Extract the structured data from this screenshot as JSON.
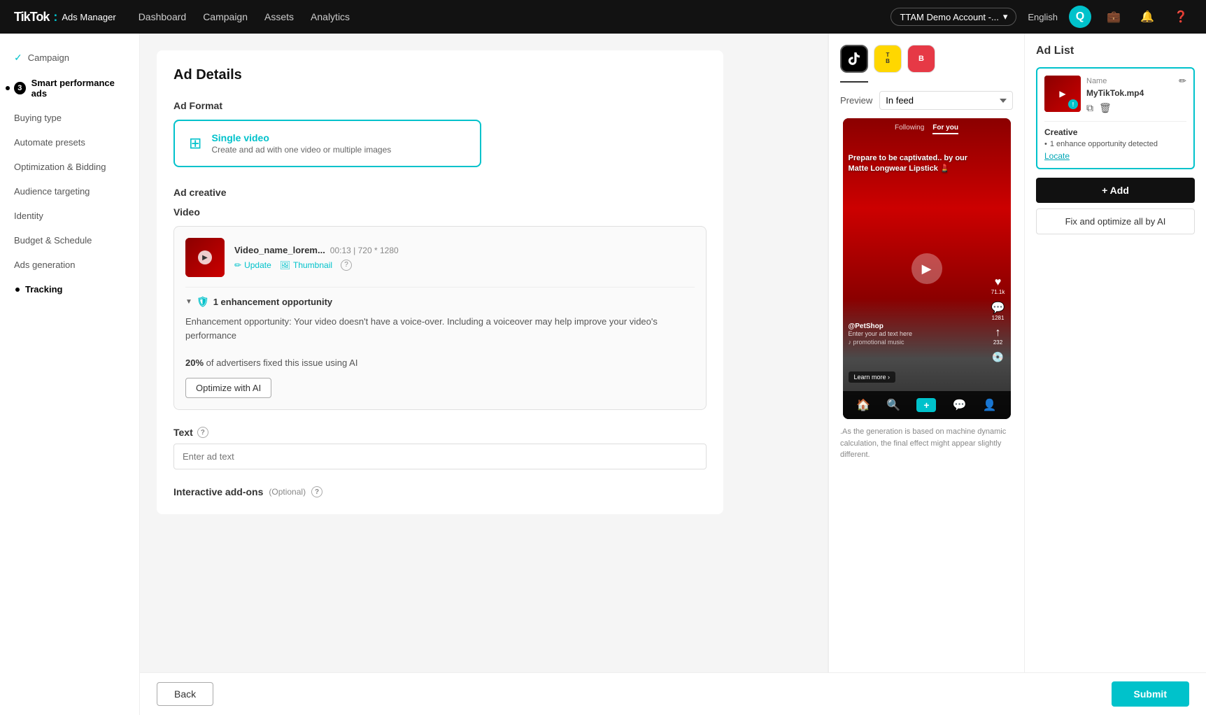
{
  "topnav": {
    "logo": "TikTok",
    "product": "Ads Manager",
    "links": [
      "Dashboard",
      "Campaign",
      "Assets",
      "Analytics"
    ],
    "account": "TTAM Demo Account -...",
    "language": "English",
    "user_initial": "Q"
  },
  "sidebar": {
    "items": [
      {
        "id": "campaign",
        "label": "Campaign",
        "state": "checked"
      },
      {
        "id": "smart-performance-ads",
        "label": "Smart performance ads",
        "state": "active",
        "step": "3"
      },
      {
        "id": "buying-type",
        "label": "Buying type",
        "state": "normal"
      },
      {
        "id": "automate-presets",
        "label": "Automate presets",
        "state": "normal"
      },
      {
        "id": "optimization-bidding",
        "label": "Optimization & Bidding",
        "state": "normal"
      },
      {
        "id": "audience-targeting",
        "label": "Audience targeting",
        "state": "normal"
      },
      {
        "id": "identity",
        "label": "Identity",
        "state": "normal"
      },
      {
        "id": "budget-schedule",
        "label": "Budget & Schedule",
        "state": "normal"
      },
      {
        "id": "ads-generation",
        "label": "Ads generation",
        "state": "normal"
      },
      {
        "id": "tracking",
        "label": "Tracking",
        "state": "dot-active"
      }
    ]
  },
  "main": {
    "page_title": "Ad Details",
    "ad_format_section": "Ad Format",
    "format_option": {
      "icon": "▣",
      "title": "Single video",
      "description": "Create and ad with one video or multiple images"
    },
    "ad_creative_section": "Ad creative",
    "video_section_label": "Video",
    "video_name": "Video_name_lorem...",
    "video_duration": "00:13",
    "video_resolution": "720 * 1280",
    "update_btn": "Update",
    "thumbnail_btn": "Thumbnail",
    "enhancement": {
      "count_label": "1 enhancement opportunity",
      "description": "Enhancement opportunity: Your video doesn't have a voice-over. Including a voiceover may help improve your video's performance",
      "stat_percent": "20%",
      "stat_label": "of advertisers fixed this issue using AI",
      "optimize_btn": "Optimize with AI"
    },
    "text_section_label": "Text",
    "text_placeholder": "Enter ad text",
    "addons_label": "Interactive add-ons",
    "addons_optional": "(Optional)",
    "back_btn": "Back",
    "submit_btn": "Submit"
  },
  "preview": {
    "label": "Preview",
    "platform_options": [
      "TikTok",
      "TopBuzz",
      "BaBe"
    ],
    "feed_options": [
      "In feed",
      "For you",
      "Following"
    ],
    "selected_feed": "In feed",
    "phone": {
      "top_tabs": [
        "Following",
        "For you"
      ],
      "active_tab": "For you",
      "overlay_text": "Prepare to be captivated.. by our Matte Longwear Lipstick 💄",
      "brand": "@PetShop",
      "ad_placeholder": "Enter your ad text here",
      "music": "♪ promotional music",
      "learn_more": "Learn more ›",
      "likes": "71.1k",
      "comments": "1281",
      "shares": "232"
    },
    "note": ".As the generation is based on machine dynamic calculation, the final effect might appear slightly different."
  },
  "ad_list": {
    "title": "Ad List",
    "item": {
      "name_label": "Name",
      "filename": "MyTikTok.mp4",
      "creative_label": "Creative",
      "opportunity": "1 enhance opportunity detected",
      "locate_label": "Locate"
    },
    "add_btn": "+ Add",
    "fix_optimize_btn": "Fix and optimize all by AI"
  }
}
